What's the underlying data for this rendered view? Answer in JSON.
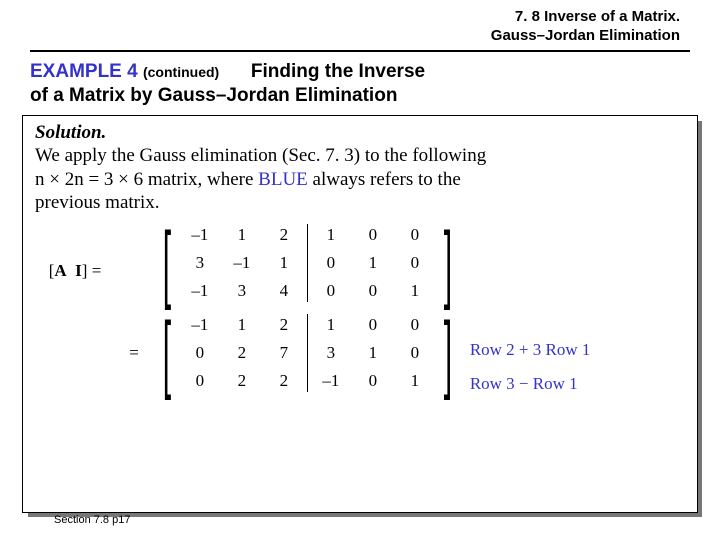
{
  "header": {
    "line1": "7. 8 Inverse of a Matrix.",
    "line2": "Gauss–Jordan Elimination"
  },
  "example": {
    "label": "EXAMPLE 4",
    "continued": "(continued)",
    "title1": "Finding the Inverse",
    "title2": "of a Matrix by Gauss–Jordan Elimination"
  },
  "solution": {
    "head": "Solution.",
    "line1a": "We apply the Gauss elimination (Sec. 7. 3) to the following",
    "line2a": "n × 2n = 3 × 6 matrix, where ",
    "blue": "BLUE",
    "line2b": " always refers to the",
    "line3": "previous matrix."
  },
  "math": {
    "lhs_open": "[",
    "lhs_A": "A",
    "lhs_I": "I",
    "lhs_close": "]",
    "lhs_eq": "=",
    "eq2": "=",
    "m1": {
      "r1": [
        "–1",
        "1",
        "2",
        "1",
        "0",
        "0"
      ],
      "r2": [
        "3",
        "–1",
        "1",
        "0",
        "1",
        "0"
      ],
      "r3": [
        "–1",
        "3",
        "4",
        "0",
        "0",
        "1"
      ]
    },
    "m2": {
      "r1": [
        "–1",
        "1",
        "2",
        "1",
        "0",
        "0"
      ],
      "r2": [
        "0",
        "2",
        "7",
        "3",
        "1",
        "0"
      ],
      "r3": [
        "0",
        "2",
        "2",
        "–1",
        "0",
        "1"
      ]
    },
    "rowops": {
      "op1": "Row 2 + 3 Row 1",
      "op2": "Row 3 − Row 1"
    }
  },
  "footer": "Section 7.8  p17"
}
